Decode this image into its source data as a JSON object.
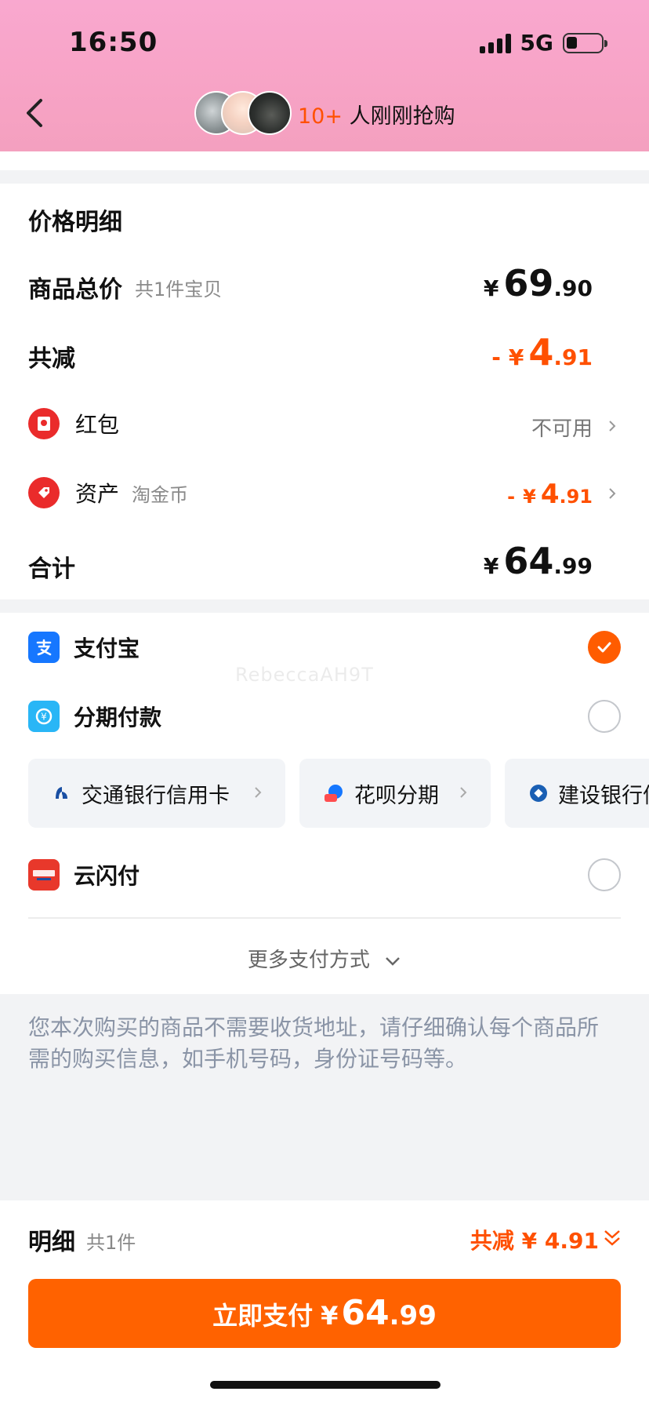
{
  "status_bar": {
    "time": "16:50",
    "network": "5G"
  },
  "header": {
    "count": "10+",
    "text": " 人刚刚抢购"
  },
  "price_detail": {
    "title": "价格明细",
    "subtotal": {
      "label": "商品总价",
      "sub": "共1件宝贝",
      "yen": "¥",
      "int": "69",
      "dec": ".90"
    },
    "discount": {
      "label": "共减",
      "prefix": "-",
      "yen": "¥",
      "int": "4",
      "dec": ".91"
    },
    "red_packet": {
      "label": "红包",
      "value": "不可用"
    },
    "assets": {
      "label": "资产",
      "sub": "淘金币",
      "prefix": "-",
      "yen": "¥",
      "int": "4",
      "dec": ".91"
    },
    "total": {
      "label": "合计",
      "yen": "¥",
      "int": "64",
      "dec": ".99"
    }
  },
  "payment": {
    "alipay": "支付宝",
    "installment": "分期付款",
    "chips": [
      "交通银行信用卡",
      "花呗分期",
      "建设银行信用卡"
    ],
    "unionpay": "云闪付",
    "more": "更多支付方式",
    "watermark": "RebeccaAH9T"
  },
  "notice": "您本次购买的商品不需要收货地址，请仔细确认每个商品所需的购买信息，如手机号码，身份证号码等。",
  "bottom": {
    "detail_label": "明细",
    "detail_sub": "共1件",
    "discount_total": "共减 ¥ 4.91",
    "pay_label": "立即支付",
    "pay_yen": "¥",
    "pay_int": "64",
    "pay_dec": ".99"
  },
  "colors": {
    "accent": "#ff6200",
    "discount": "#ff5000",
    "header_pink": "#f7a3c5"
  }
}
